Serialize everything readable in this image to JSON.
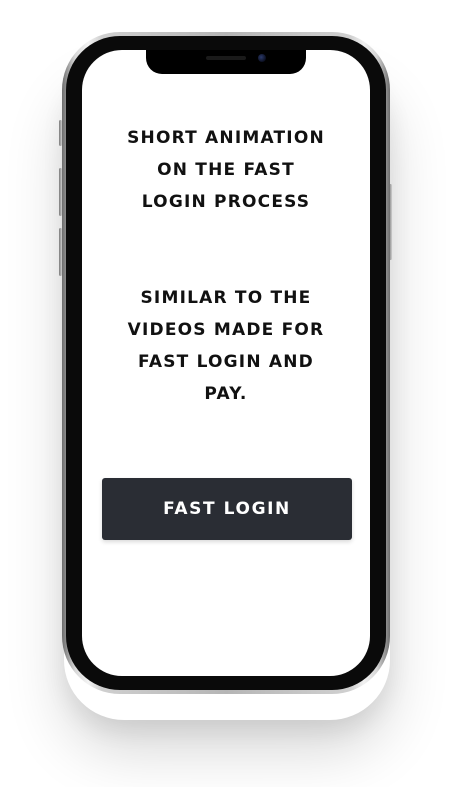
{
  "screen": {
    "heading": "SHORT ANIMATION\nON THE FAST\nLOGIN PROCESS",
    "description": "SIMILAR TO THE\nVIDEOS MADE FOR\nFAST LOGIN AND\nPAY.",
    "primary_button_label": "FAST LOGIN"
  },
  "colors": {
    "button_background": "#2a2d34",
    "button_text": "#ffffff",
    "screen_background": "#ffffff",
    "text": "#111111"
  }
}
